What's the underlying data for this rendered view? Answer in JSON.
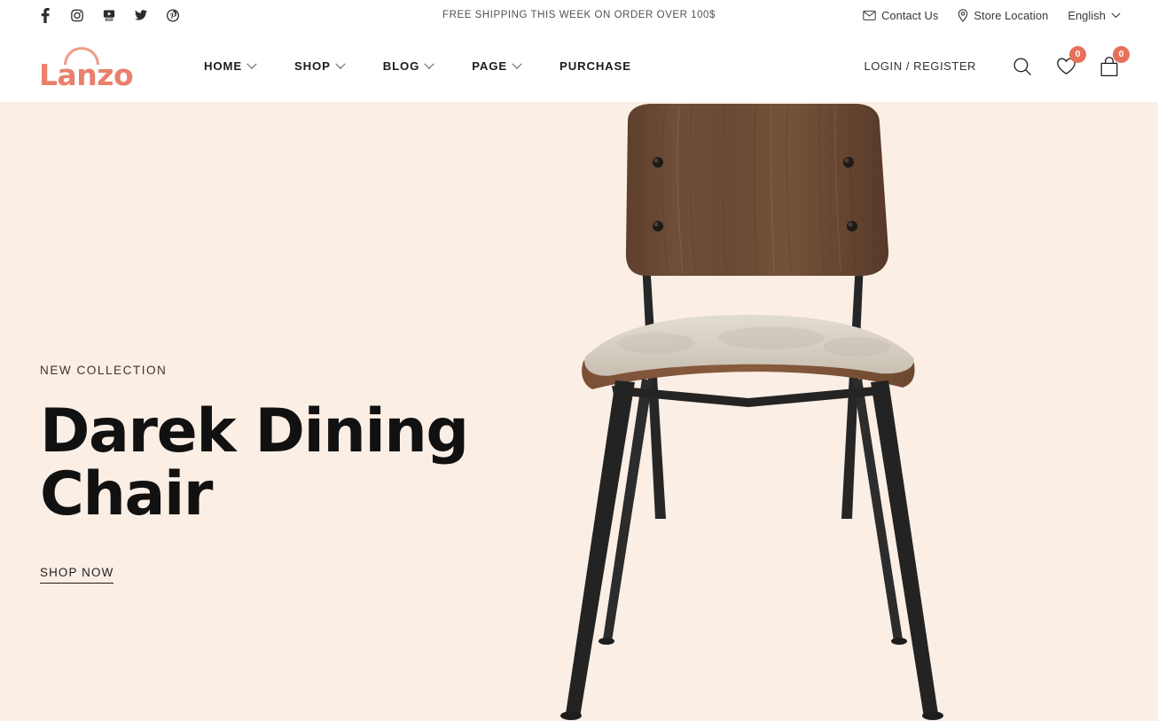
{
  "topbar": {
    "social": [
      {
        "name": "facebook-icon",
        "label": "Facebook"
      },
      {
        "name": "instagram-icon",
        "label": "Instagram"
      },
      {
        "name": "youtube-icon",
        "label": "YouTube"
      },
      {
        "name": "twitter-icon",
        "label": "Twitter"
      },
      {
        "name": "pinterest-icon",
        "label": "Pinterest"
      }
    ],
    "promo": "FREE SHIPPING THIS WEEK ON ORDER OVER 100$",
    "contact_label": "Contact Us",
    "store_label": "Store Location",
    "language": "English"
  },
  "header": {
    "logo_text": "Lanzo",
    "nav": [
      {
        "label": "HOME",
        "has_dropdown": true
      },
      {
        "label": "SHOP",
        "has_dropdown": true
      },
      {
        "label": "BLOG",
        "has_dropdown": true
      },
      {
        "label": "PAGE",
        "has_dropdown": true
      },
      {
        "label": "PURCHASE",
        "has_dropdown": false
      }
    ],
    "login_label": "LOGIN / REGISTER",
    "wishlist_count": "0",
    "cart_count": "0"
  },
  "hero": {
    "eyebrow": "NEW COLLECTION",
    "headline": "Darek Dining Chair",
    "cta_label": "SHOP NOW",
    "product_image_alt": "Darek Dining Chair"
  },
  "colors": {
    "brand": "#e8806c",
    "badge": "#e8705a",
    "hero_background": "#fbeee5",
    "text": "#111111",
    "wood": "#6b4a36",
    "cushion": "#d9d2c8",
    "metal": "#242424"
  }
}
